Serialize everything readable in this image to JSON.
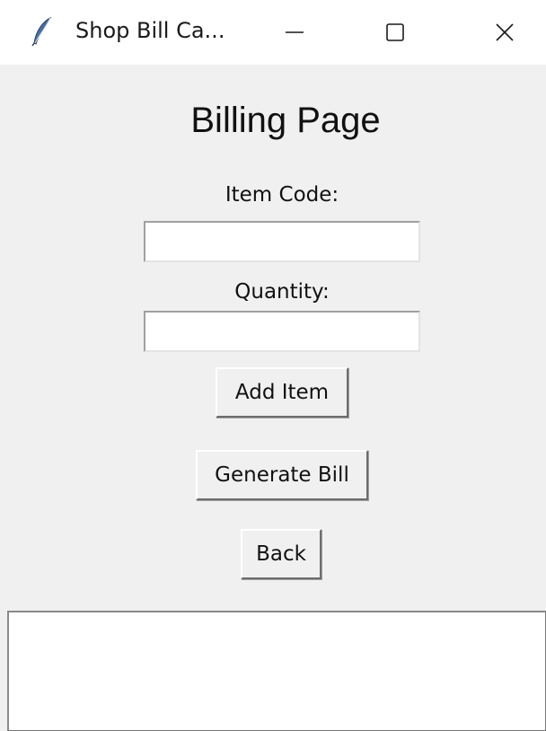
{
  "window": {
    "title": "Shop Bill Ca...",
    "controls": {
      "minimize_icon": "minimize-icon",
      "maximize_icon": "maximize-icon",
      "close_icon": "close-icon"
    }
  },
  "page": {
    "heading": "Billing Page"
  },
  "form": {
    "item_code_label": "Item Code:",
    "item_code_value": "",
    "quantity_label": "Quantity:",
    "quantity_value": ""
  },
  "buttons": {
    "add_item": "Add Item",
    "generate_bill": "Generate Bill",
    "back": "Back"
  },
  "bill": {
    "content": ""
  },
  "colors": {
    "background": "#f0f0f0",
    "titlebar": "#ffffff",
    "field": "#ffffff",
    "text": "#111111"
  }
}
